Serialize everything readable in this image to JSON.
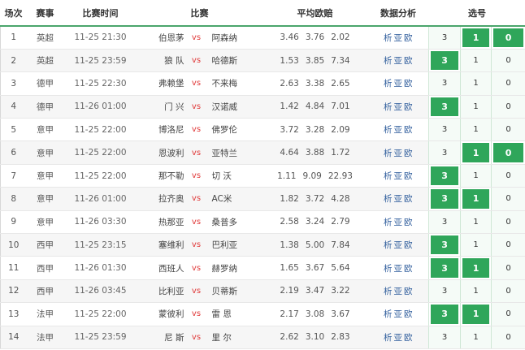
{
  "headers": {
    "idx": "场次",
    "league": "赛事",
    "time": "比赛时间",
    "match": "比赛",
    "odds": "平均欧赔",
    "analysis": "数据分析",
    "picks": "选号"
  },
  "analysis_links": [
    "析",
    "亚",
    "欧"
  ],
  "vs_label": "vs",
  "colors": {
    "accent_green": "#2fa65a",
    "header_rule": "#4aa56b",
    "vs_red": "#e03a3a",
    "link_blue": "#2f5d9c"
  },
  "rows": [
    {
      "idx": "1",
      "league": "英超",
      "time": "11-25 21:30",
      "home": "伯恩茅",
      "away": "阿森纳",
      "odds": [
        "3.46",
        "3.76",
        "2.02"
      ],
      "picks": [
        "3",
        "1",
        "0"
      ],
      "selected": [
        false,
        true,
        true
      ]
    },
    {
      "idx": "2",
      "league": "英超",
      "time": "11-25 23:59",
      "home": "狼 队",
      "away": "哈德斯",
      "odds": [
        "1.53",
        "3.85",
        "7.34"
      ],
      "picks": [
        "3",
        "1",
        "0"
      ],
      "selected": [
        true,
        false,
        false
      ]
    },
    {
      "idx": "3",
      "league": "德甲",
      "time": "11-25 22:30",
      "home": "弗赖堡",
      "away": "不来梅",
      "odds": [
        "2.63",
        "3.38",
        "2.65"
      ],
      "picks": [
        "3",
        "1",
        "0"
      ],
      "selected": [
        false,
        false,
        false
      ]
    },
    {
      "idx": "4",
      "league": "德甲",
      "time": "11-26 01:00",
      "home": "门 兴",
      "away": "汉诺威",
      "odds": [
        "1.42",
        "4.84",
        "7.01"
      ],
      "picks": [
        "3",
        "1",
        "0"
      ],
      "selected": [
        true,
        false,
        false
      ]
    },
    {
      "idx": "5",
      "league": "意甲",
      "time": "11-25 22:00",
      "home": "博洛尼",
      "away": "佛罗伦",
      "odds": [
        "3.72",
        "3.28",
        "2.09"
      ],
      "picks": [
        "3",
        "1",
        "0"
      ],
      "selected": [
        false,
        false,
        false
      ]
    },
    {
      "idx": "6",
      "league": "意甲",
      "time": "11-25 22:00",
      "home": "恩波利",
      "away": "亚特兰",
      "odds": [
        "4.64",
        "3.88",
        "1.72"
      ],
      "picks": [
        "3",
        "1",
        "0"
      ],
      "selected": [
        false,
        true,
        true
      ]
    },
    {
      "idx": "7",
      "league": "意甲",
      "time": "11-25 22:00",
      "home": "那不勒",
      "away": "切 沃",
      "odds": [
        "1.11",
        "9.09",
        "22.93"
      ],
      "picks": [
        "3",
        "1",
        "0"
      ],
      "selected": [
        true,
        false,
        false
      ]
    },
    {
      "idx": "8",
      "league": "意甲",
      "time": "11-26 01:00",
      "home": "拉齐奥",
      "away": "AC米",
      "odds": [
        "1.82",
        "3.72",
        "4.28"
      ],
      "picks": [
        "3",
        "1",
        "0"
      ],
      "selected": [
        true,
        true,
        false
      ]
    },
    {
      "idx": "9",
      "league": "意甲",
      "time": "11-26 03:30",
      "home": "热那亚",
      "away": "桑普多",
      "odds": [
        "2.58",
        "3.24",
        "2.79"
      ],
      "picks": [
        "3",
        "1",
        "0"
      ],
      "selected": [
        false,
        false,
        false
      ]
    },
    {
      "idx": "10",
      "league": "西甲",
      "time": "11-25 23:15",
      "home": "塞维利",
      "away": "巴利亚",
      "odds": [
        "1.38",
        "5.00",
        "7.84"
      ],
      "picks": [
        "3",
        "1",
        "0"
      ],
      "selected": [
        true,
        false,
        false
      ]
    },
    {
      "idx": "11",
      "league": "西甲",
      "time": "11-26 01:30",
      "home": "西班人",
      "away": "赫罗纳",
      "odds": [
        "1.65",
        "3.67",
        "5.64"
      ],
      "picks": [
        "3",
        "1",
        "0"
      ],
      "selected": [
        true,
        true,
        false
      ]
    },
    {
      "idx": "12",
      "league": "西甲",
      "time": "11-26 03:45",
      "home": "比利亚",
      "away": "贝蒂斯",
      "odds": [
        "2.19",
        "3.47",
        "3.22"
      ],
      "picks": [
        "3",
        "1",
        "0"
      ],
      "selected": [
        false,
        false,
        false
      ]
    },
    {
      "idx": "13",
      "league": "法甲",
      "time": "11-25 22:00",
      "home": "蒙彼利",
      "away": "雷 恩",
      "odds": [
        "2.17",
        "3.08",
        "3.67"
      ],
      "picks": [
        "3",
        "1",
        "0"
      ],
      "selected": [
        true,
        true,
        false
      ]
    },
    {
      "idx": "14",
      "league": "法甲",
      "time": "11-25 23:59",
      "home": "尼 斯",
      "away": "里 尔",
      "odds": [
        "2.62",
        "3.10",
        "2.83"
      ],
      "picks": [
        "3",
        "1",
        "0"
      ],
      "selected": [
        false,
        false,
        false
      ]
    }
  ]
}
